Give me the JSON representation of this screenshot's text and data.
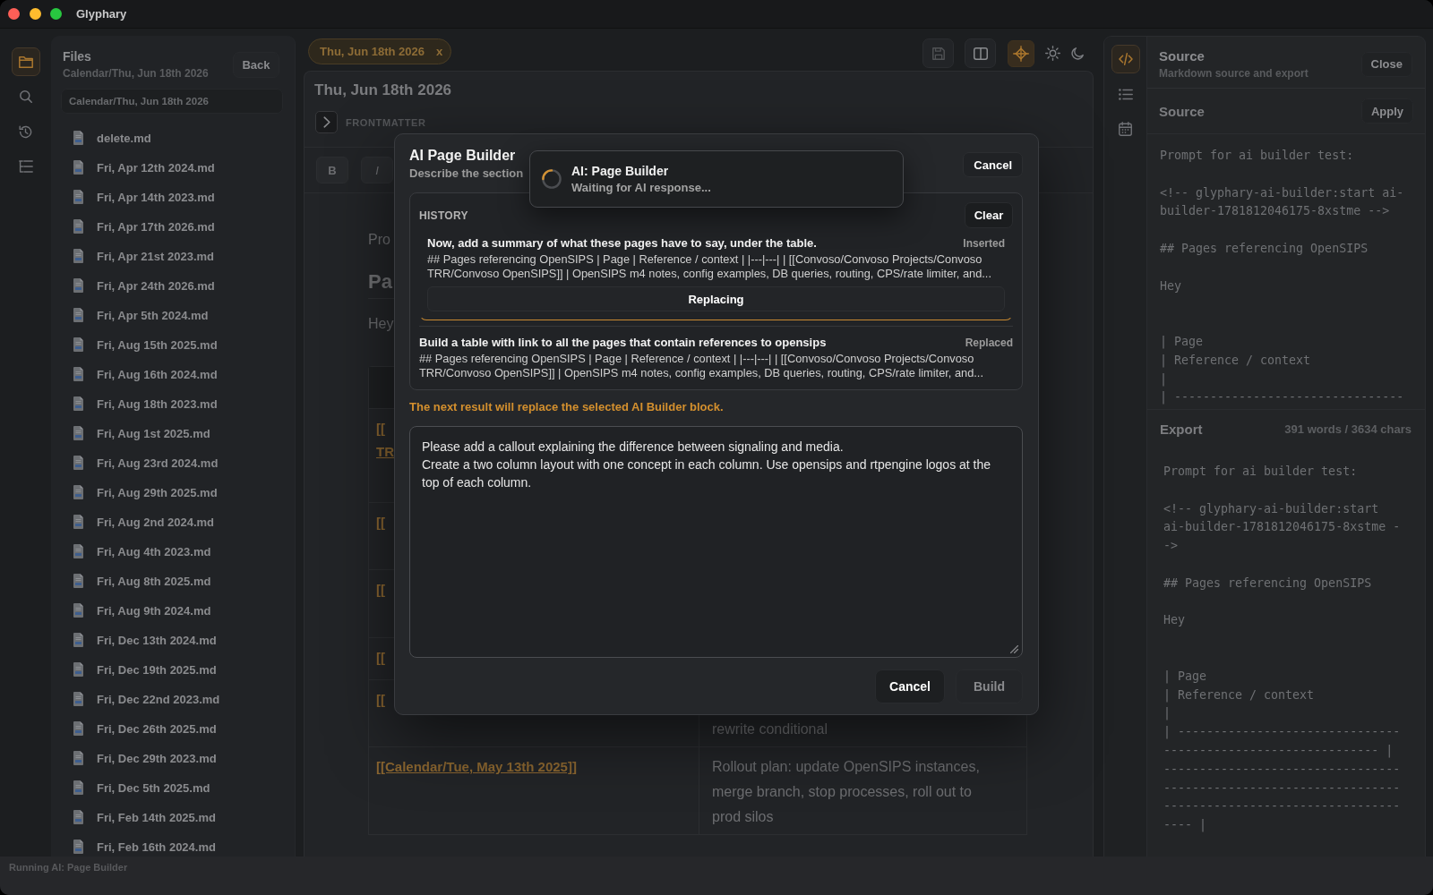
{
  "window": {
    "title": "Glyphary"
  },
  "left_rail": [
    {
      "kind": "folder",
      "selected": true
    },
    {
      "kind": "search",
      "selected": false
    },
    {
      "kind": "history",
      "selected": false
    },
    {
      "kind": "outline",
      "selected": false
    }
  ],
  "files_panel": {
    "title": "Files",
    "subtitle": "Calendar/Thu, Jun 18th 2026",
    "back_button": "Back",
    "path": "Calendar/Thu, Jun 18th 2026",
    "files": [
      "delete.md",
      "Fri, Apr 12th 2024.md",
      "Fri, Apr 14th 2023.md",
      "Fri, Apr 17th 2026.md",
      "Fri, Apr 21st 2023.md",
      "Fri, Apr 24th 2026.md",
      "Fri, Apr 5th 2024.md",
      "Fri, Aug 15th 2025.md",
      "Fri, Aug 16th 2024.md",
      "Fri, Aug 18th 2023.md",
      "Fri, Aug 1st 2025.md",
      "Fri, Aug 23rd 2024.md",
      "Fri, Aug 29th 2025.md",
      "Fri, Aug 2nd 2024.md",
      "Fri, Aug 4th 2023.md",
      "Fri, Aug 8th 2025.md",
      "Fri, Aug 9th 2024.md",
      "Fri, Dec 13th 2024.md",
      "Fri, Dec 19th 2025.md",
      "Fri, Dec 22nd 2023.md",
      "Fri, Dec 26th 2025.md",
      "Fri, Dec 29th 2023.md",
      "Fri, Dec 5th 2025.md",
      "Fri, Feb 14th 2025.md",
      "Fri, Feb 16th 2024.md"
    ]
  },
  "editor": {
    "tabs": [
      {
        "label": "Thu, Jun 18th 2026",
        "close": "x",
        "selected": true
      }
    ],
    "document_actions": [
      {
        "kind": "save",
        "disabled": true
      },
      {
        "kind": "columns",
        "disabled": false
      }
    ],
    "view_modes": [
      {
        "kind": "crosshair",
        "selected": true
      },
      {
        "kind": "sun",
        "selected": false
      },
      {
        "kind": "moon",
        "selected": false
      }
    ],
    "title": "Thu, Jun 18th 2026",
    "frontmatter_label": "FRONTMATTER",
    "format_buttons": [
      {
        "kind": "bold",
        "label": "B"
      },
      {
        "kind": "italic",
        "label": "I"
      }
    ],
    "content": {
      "paragraph": "Pro",
      "heading": "Pa",
      "text": "Hey",
      "table": {
        "rows": [
          {
            "column_1": "[[\nTR"
          },
          {
            "column_1": "[["
          },
          {
            "column_1": "[["
          },
          {
            "column_1": "[["
          },
          {
            "column_1": "[[",
            "column_2": "rewrite conditional"
          },
          {
            "column_1": "[[Calendar/Tue, May 13th 2025]]",
            "column_2": "Rollout plan: update OpenSIPS instances, merge branch, stop processes, roll out to prod silos"
          }
        ]
      }
    }
  },
  "right_rail": [
    {
      "kind": "code",
      "selected": true
    },
    {
      "kind": "list",
      "selected": false
    },
    {
      "kind": "calendar",
      "selected": false
    }
  ],
  "source_panel": {
    "title": "Source",
    "subtitle": "Markdown source and export",
    "close_button": "Close",
    "source_heading": "Source",
    "apply_button": "Apply",
    "source_text": "Prompt for ai builder test:\n\n<!-- glyphary-ai-builder:start ai-\nbuilder-1781812046175-8xstme -->\n\n## Pages referencing OpenSIPS\n\nHey\n\n\n| Page\n| Reference / context\n|\n| --------------------------------",
    "export_heading": "Export",
    "export_stats": "391 words / 3634 chars",
    "export_text": "Prompt for ai builder test:\n\n<!-- glyphary-ai-builder:start\nai-builder-1781812046175-8xstme -\n->\n\n## Pages referencing OpenSIPS\n\nHey\n\n\n| Page\n| Reference / context\n|\n| -------------------------------\n------------------------------ |\n---------------------------------\n---------------------------------\n---------------------------------\n---- |"
  },
  "status_bar": {
    "text": "Running AI: Page Builder"
  },
  "modal": {
    "title": "AI Page Builder",
    "subtitle": "Describe the section",
    "cancel_button": "Cancel",
    "history": {
      "label": "HISTORY",
      "clear_button": "Clear",
      "items": [
        {
          "title": "Now, add a summary of what these pages have to say, under the table.",
          "status": "Inserted",
          "preview": "## Pages referencing OpenSIPS | Page | Reference / context | |---|---| | [[Convoso/Convoso Projects/Convoso\nTRR/Convoso OpenSIPS]] | OpenSIPS m4 notes, config examples, DB queries, routing, CPS/rate limiter, and...",
          "action": "Replacing",
          "selected": true
        },
        {
          "title": "Build a table with link to all the pages that contain references to opensips",
          "status": "Replaced",
          "preview": "## Pages referencing OpenSIPS | Page | Reference / context | |---|---| | [[Convoso/Convoso Projects/Convoso\nTRR/Convoso OpenSIPS]] | OpenSIPS m4 notes, config examples, DB queries, routing, CPS/rate limiter, and...",
          "selected": false
        }
      ]
    },
    "note": "The next result will replace the selected AI Builder block.",
    "prompt": "Please add a callout explaining the difference between signaling and media.\nCreate a two column layout with one concept in each column. Use opensips and rtpengine logos at the top of each column.",
    "buttons": [
      {
        "kind": "cancel",
        "label": "Cancel",
        "disabled": false
      },
      {
        "kind": "build",
        "label": "Build",
        "disabled": true
      }
    ]
  },
  "toast": {
    "title": "AI: Page Builder",
    "message": "Waiting for AI response..."
  }
}
